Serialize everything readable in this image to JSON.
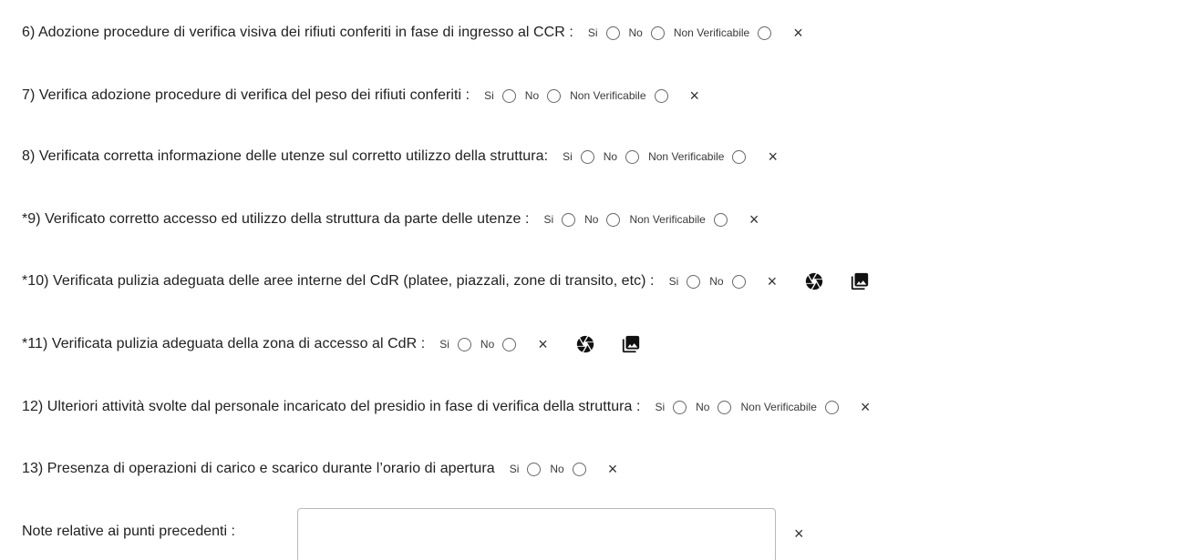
{
  "labels": {
    "si": "Si",
    "no": "No",
    "nv": "Non Verificabile",
    "clear": "×"
  },
  "questions": [
    {
      "text": "6) Adozione procedure di verifica visiva dei rifiuti conferiti in fase di ingresso al CCR :"
    },
    {
      "text": "7) Verifica adozione procedure di verifica del peso dei rifiuti conferiti :"
    },
    {
      "text": "8) Verificata corretta informazione delle utenze sul corretto utilizzo della struttura:"
    },
    {
      "text": "*9) Verificato corretto accesso ed utilizzo della struttura da parte delle utenze :"
    },
    {
      "text": "*10) Verificata pulizia adeguata delle aree interne del CdR (platee, piazzali, zone di transito, etc) :"
    },
    {
      "text": "*11) Verificata pulizia adeguata della zona di accesso al CdR :"
    },
    {
      "text": "12) Ulteriori attività svolte dal personale incaricato del presidio in fase di verifica della struttura :"
    },
    {
      "text": "13) Presenza di operazioni di carico e scarico durante l’orario di apertura"
    }
  ],
  "note": {
    "label": "Note relative ai punti precedenti :",
    "value": ""
  },
  "icons": {
    "radio": "radio-unchecked-icon",
    "clear": "close-icon",
    "camera": "camera-shutter-icon",
    "gallery": "photo-library-icon"
  }
}
